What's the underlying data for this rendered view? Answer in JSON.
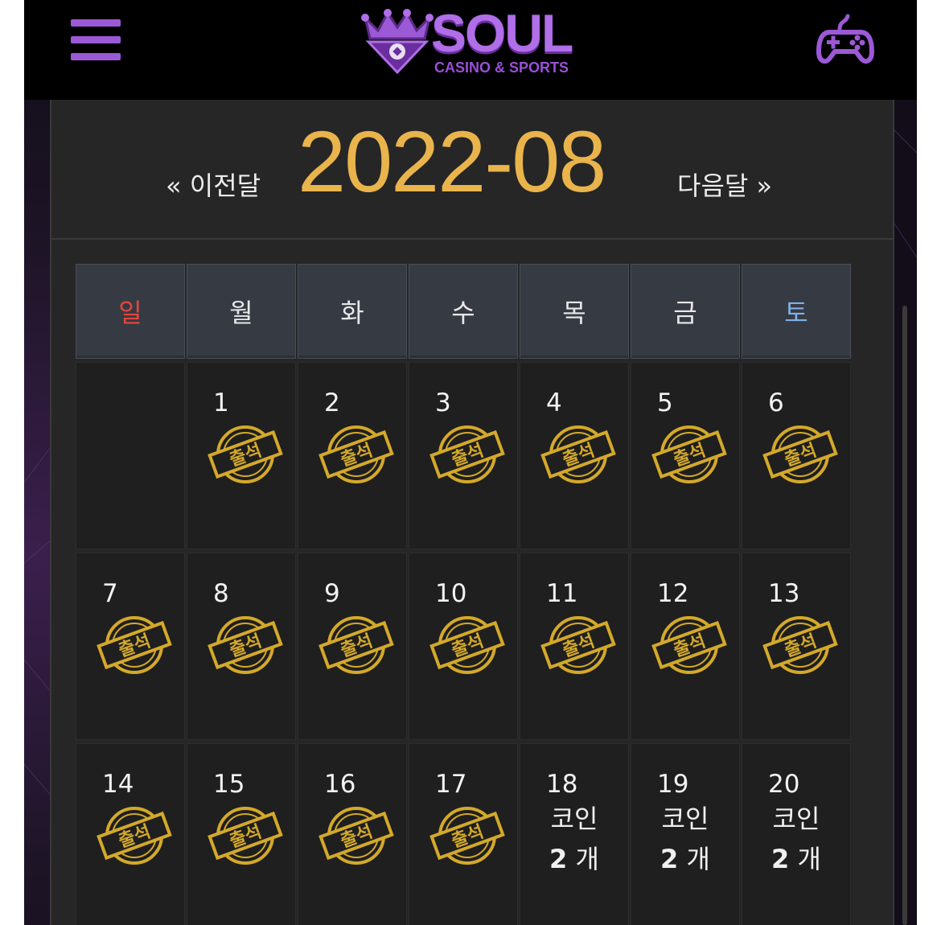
{
  "header": {
    "brand_name": "SOUL",
    "brand_sub": "CASINO & SPORTS",
    "colors": {
      "brand_purple": "#b06ee8",
      "header_bg": "#000000"
    },
    "menu_icon": "hamburger-icon",
    "game_icon": "gamepad-icon"
  },
  "calendar": {
    "prev_label": "« 이전달",
    "month_label": "2022-08",
    "next_label": "다음달 »",
    "colors": {
      "month": "#e9b44c",
      "sunday": "#e4473c",
      "saturday": "#7fb0e8",
      "stamp": "#d4a92a"
    },
    "weekdays": [
      "일",
      "월",
      "화",
      "수",
      "목",
      "금",
      "토"
    ],
    "stamp_text": "출석",
    "weeks": [
      [
        {
          "day": ""
        },
        {
          "day": "1",
          "stamp": true
        },
        {
          "day": "2",
          "stamp": true
        },
        {
          "day": "3",
          "stamp": true
        },
        {
          "day": "4",
          "stamp": true
        },
        {
          "day": "5",
          "stamp": true
        },
        {
          "day": "6",
          "stamp": true
        }
      ],
      [
        {
          "day": "7",
          "stamp": true
        },
        {
          "day": "8",
          "stamp": true
        },
        {
          "day": "9",
          "stamp": true
        },
        {
          "day": "10",
          "stamp": true
        },
        {
          "day": "11",
          "stamp": true
        },
        {
          "day": "12",
          "stamp": true
        },
        {
          "day": "13",
          "stamp": true
        }
      ],
      [
        {
          "day": "14",
          "stamp": true
        },
        {
          "day": "15",
          "stamp": true
        },
        {
          "day": "16",
          "stamp": true
        },
        {
          "day": "17",
          "stamp": true
        },
        {
          "day": "18",
          "coin_label": "코인",
          "coin_count": "2",
          "coin_unit": " 개"
        },
        {
          "day": "19",
          "coin_label": "코인",
          "coin_count": "2",
          "coin_unit": " 개"
        },
        {
          "day": "20",
          "coin_label": "코인",
          "coin_count": "2",
          "coin_unit": " 개"
        }
      ]
    ]
  }
}
